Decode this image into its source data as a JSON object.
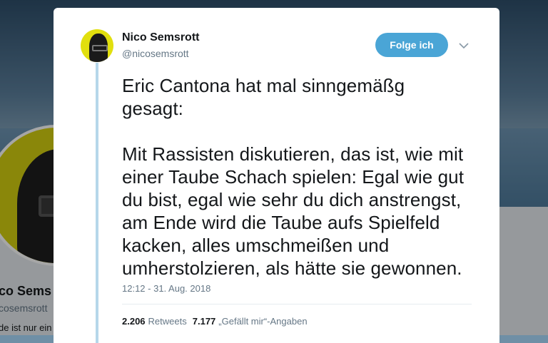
{
  "background_profile": {
    "name": "co Sems",
    "handle": "cosemsrott",
    "bio": "de ist nur ein"
  },
  "tweet": {
    "author": {
      "display_name": "Nico Semsrott",
      "username": "@nicosemsrott"
    },
    "follow_label": "Folge ich",
    "text": "Eric Cantona hat mal sinngemäßg\ngesagt:\n\nMit Rassisten diskutieren, das ist, wie mit\neiner Taube Schach spielen: Egal wie gut\ndu bist, egal wie sehr du dich anstrengst,\nam Ende wird die Taube aufs Spielfeld\nkacken, alles umschmeißen und\numherstolzieren, als hätte sie gewonnen.",
    "timestamp": "12:12 - 31. Aug. 2018",
    "retweets_count": "2.206",
    "retweets_label": "Retweets",
    "likes_count": "7.177",
    "likes_label": "„Gefällt mir“-Angaben"
  },
  "colors": {
    "accent": "#4aa5d6",
    "thread_line": "#b6d7ea",
    "avatar_bg": "#e1df0e"
  },
  "icons": {
    "menu": "chevron-down-icon"
  }
}
